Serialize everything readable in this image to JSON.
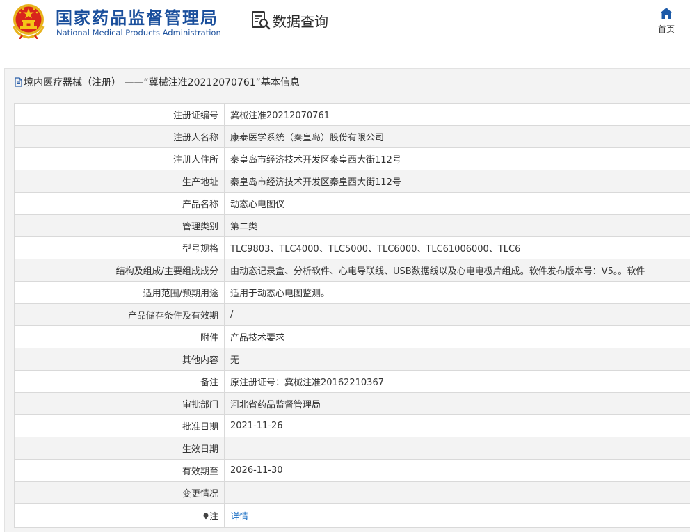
{
  "header": {
    "agency_name_cn": "国家药品监督管理局",
    "agency_name_en": "National Medical Products Administration",
    "query_label": "数据查询",
    "home_label": "首页"
  },
  "panel": {
    "title": "境内医疗器械（注册） ——“冀械注准20212070761”基本信息"
  },
  "rows": [
    {
      "label": "注册证编号",
      "value": "冀械注准20212070761"
    },
    {
      "label": "注册人名称",
      "value": "康泰医学系统（秦皇岛）股份有限公司"
    },
    {
      "label": "注册人住所",
      "value": "秦皇岛市经济技术开发区秦皇西大街112号"
    },
    {
      "label": "生产地址",
      "value": "秦皇岛市经济技术开发区秦皇西大街112号"
    },
    {
      "label": "产品名称",
      "value": "动态心电图仪"
    },
    {
      "label": "管理类别",
      "value": "第二类"
    },
    {
      "label": "型号规格",
      "value": "TLC9803、TLC4000、TLC5000、TLC6000、TLC61006000、TLC6"
    },
    {
      "label": "结构及组成/主要组成成分",
      "value": "由动态记录盒、分析软件、心电导联线、USB数据线以及心电电极片组成。软件发布版本号：V5。。软件"
    },
    {
      "label": "适用范围/预期用途",
      "value": "适用于动态心电图监测。"
    },
    {
      "label": "产品储存条件及有效期",
      "value": "/"
    },
    {
      "label": "附件",
      "value": "产品技术要求"
    },
    {
      "label": "其他内容",
      "value": "无"
    },
    {
      "label": "备注",
      "value": "原注册证号：冀械注准20162210367"
    },
    {
      "label": "审批部门",
      "value": "河北省药品监督管理局"
    },
    {
      "label": "批准日期",
      "value": "2021-11-26"
    },
    {
      "label": "生效日期",
      "value": ""
    },
    {
      "label": "有效期至",
      "value": "2026-11-30"
    },
    {
      "label": "变更情况",
      "value": ""
    }
  ],
  "note_row": {
    "label": "注",
    "link_text": "详情",
    "icon": "pin-icon"
  },
  "colors": {
    "brand_blue": "#1a4f9c",
    "link_blue": "#1a6fc4",
    "row_alt": "#f3f3f3",
    "border": "#d9d9d9"
  }
}
